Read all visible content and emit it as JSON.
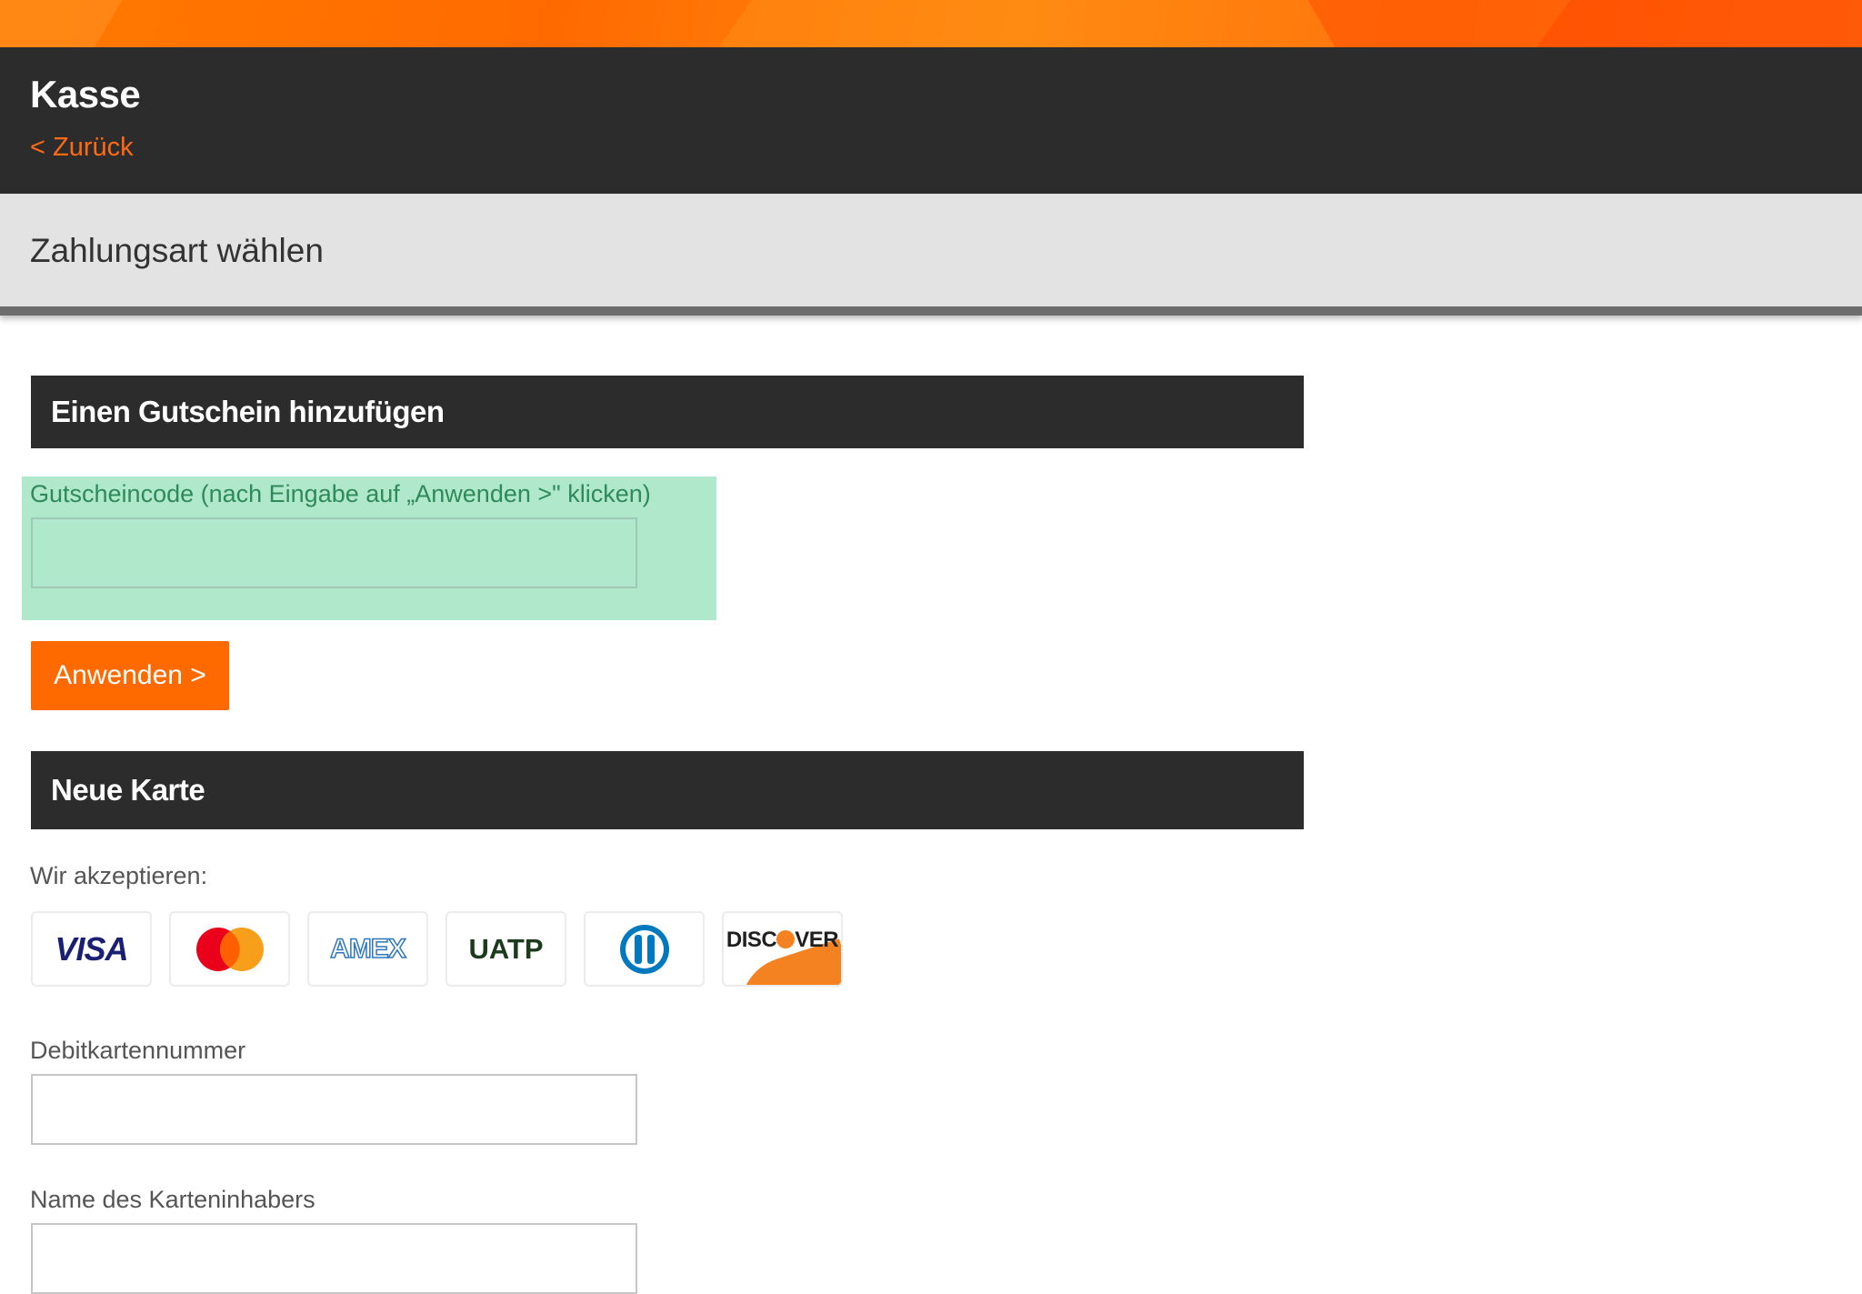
{
  "header": {
    "title": "Kasse",
    "back_link": "< Zurück"
  },
  "subheader": {
    "title": "Zahlungsart wählen"
  },
  "voucher": {
    "section_title": "Einen Gutschein hinzufügen",
    "field_label": "Gutscheincode (nach Eingabe auf „Anwenden >\" klicken)",
    "field_value": "",
    "apply_button": "Anwenden >"
  },
  "new_card": {
    "section_title": "Neue Karte",
    "accept_label": "Wir akzeptieren:",
    "card_brands": [
      {
        "name": "VISA",
        "icon": "visa-logo"
      },
      {
        "name": "Mastercard",
        "icon": "mastercard-logo"
      },
      {
        "name": "AMEX",
        "icon": "amex-logo"
      },
      {
        "name": "UATP",
        "icon": "uatp-logo"
      },
      {
        "name": "Diners Club",
        "icon": "diners-club-logo"
      },
      {
        "name": "DISCOVER",
        "icon": "discover-logo"
      }
    ],
    "debit_label": "Debitkartennummer",
    "debit_value": "",
    "holder_label": "Name des Karteninhabers",
    "holder_value": ""
  },
  "colors": {
    "accent_orange": "#ff6a00",
    "dark_bar": "#2c2c2c",
    "subheader_bg": "#e3e3e3",
    "highlight_green": "#b0e8cc"
  }
}
